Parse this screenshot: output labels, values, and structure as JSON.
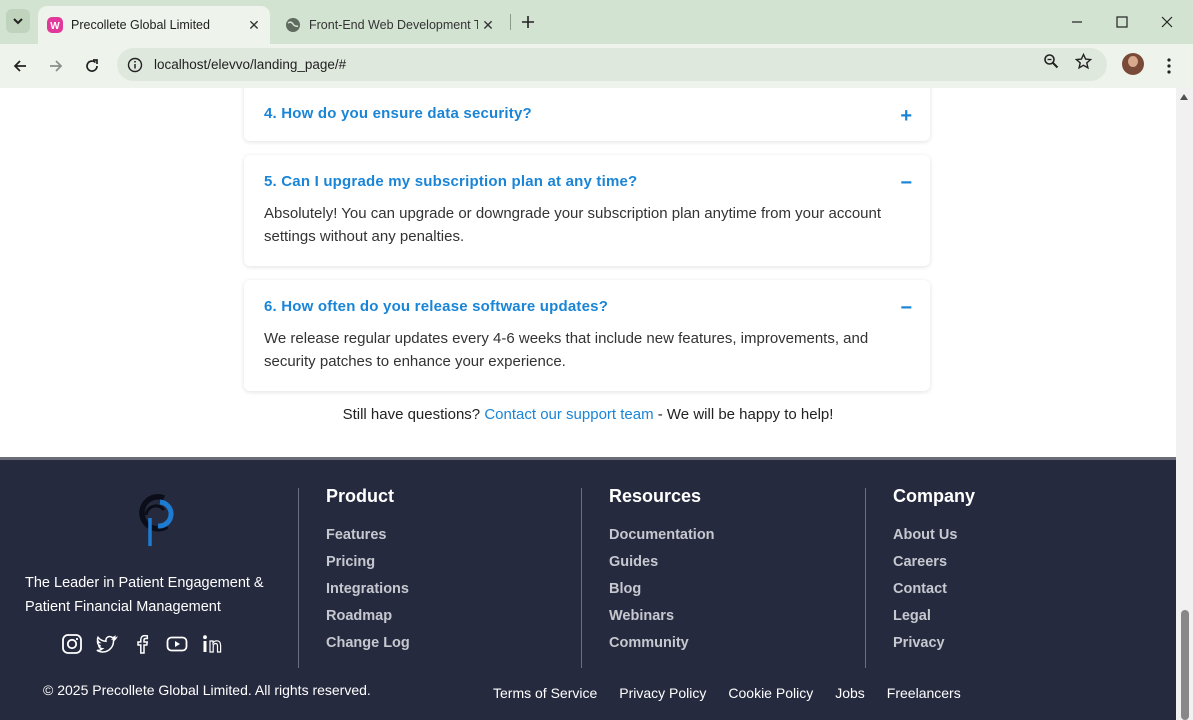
{
  "browser": {
    "tabs": [
      {
        "title": "Precollete Global Limited",
        "active": true,
        "favicon": "wp-favicon-icon"
      },
      {
        "title": "Front-End Web Development Ta",
        "active": false,
        "favicon": "globe-icon"
      }
    ],
    "url": "localhost/elevvo/landing_page/#"
  },
  "faq": {
    "items": [
      {
        "question": "4. How do you ensure data security?",
        "toggle": "+",
        "answer": ""
      },
      {
        "question": "5. Can I upgrade my subscription plan at any time?",
        "toggle": "−",
        "answer": "Absolutely! You can upgrade or downgrade your subscription plan anytime from your account settings without any penalties."
      },
      {
        "question": "6. How often do you release software updates?",
        "toggle": "−",
        "answer": "We release regular updates every 4-6 weeks that include new features, improvements, and security patches to enhance your experience."
      }
    ],
    "still_prefix": "Still have questions? ",
    "still_link": "Contact our support team",
    "still_suffix": " - We will be happy to help!"
  },
  "footer": {
    "tagline": "The Leader in Patient Engagement & Patient Financial Management",
    "social": [
      "instagram-icon",
      "twitter-icon",
      "facebook-icon",
      "youtube-icon",
      "linkedin-icon"
    ],
    "columns": [
      {
        "heading": "Product",
        "links": [
          "Features",
          "Pricing",
          "Integrations",
          "Roadmap",
          "Change Log"
        ]
      },
      {
        "heading": "Resources",
        "links": [
          "Documentation",
          "Guides",
          "Blog",
          "Webinars",
          "Community"
        ]
      },
      {
        "heading": "Company",
        "links": [
          "About Us",
          "Careers",
          "Contact",
          "Legal",
          "Privacy"
        ]
      }
    ],
    "copyright": "© 2025 Precollete Global Limited. All rights reserved.",
    "legal_links": [
      "Terms of Service",
      "Privacy Policy",
      "Cookie Policy",
      "Jobs",
      "Freelancers"
    ]
  },
  "colors": {
    "accent": "#1a85d6",
    "footer_bg": "#262a3e",
    "chrome_bg": "#d3e3d2"
  }
}
